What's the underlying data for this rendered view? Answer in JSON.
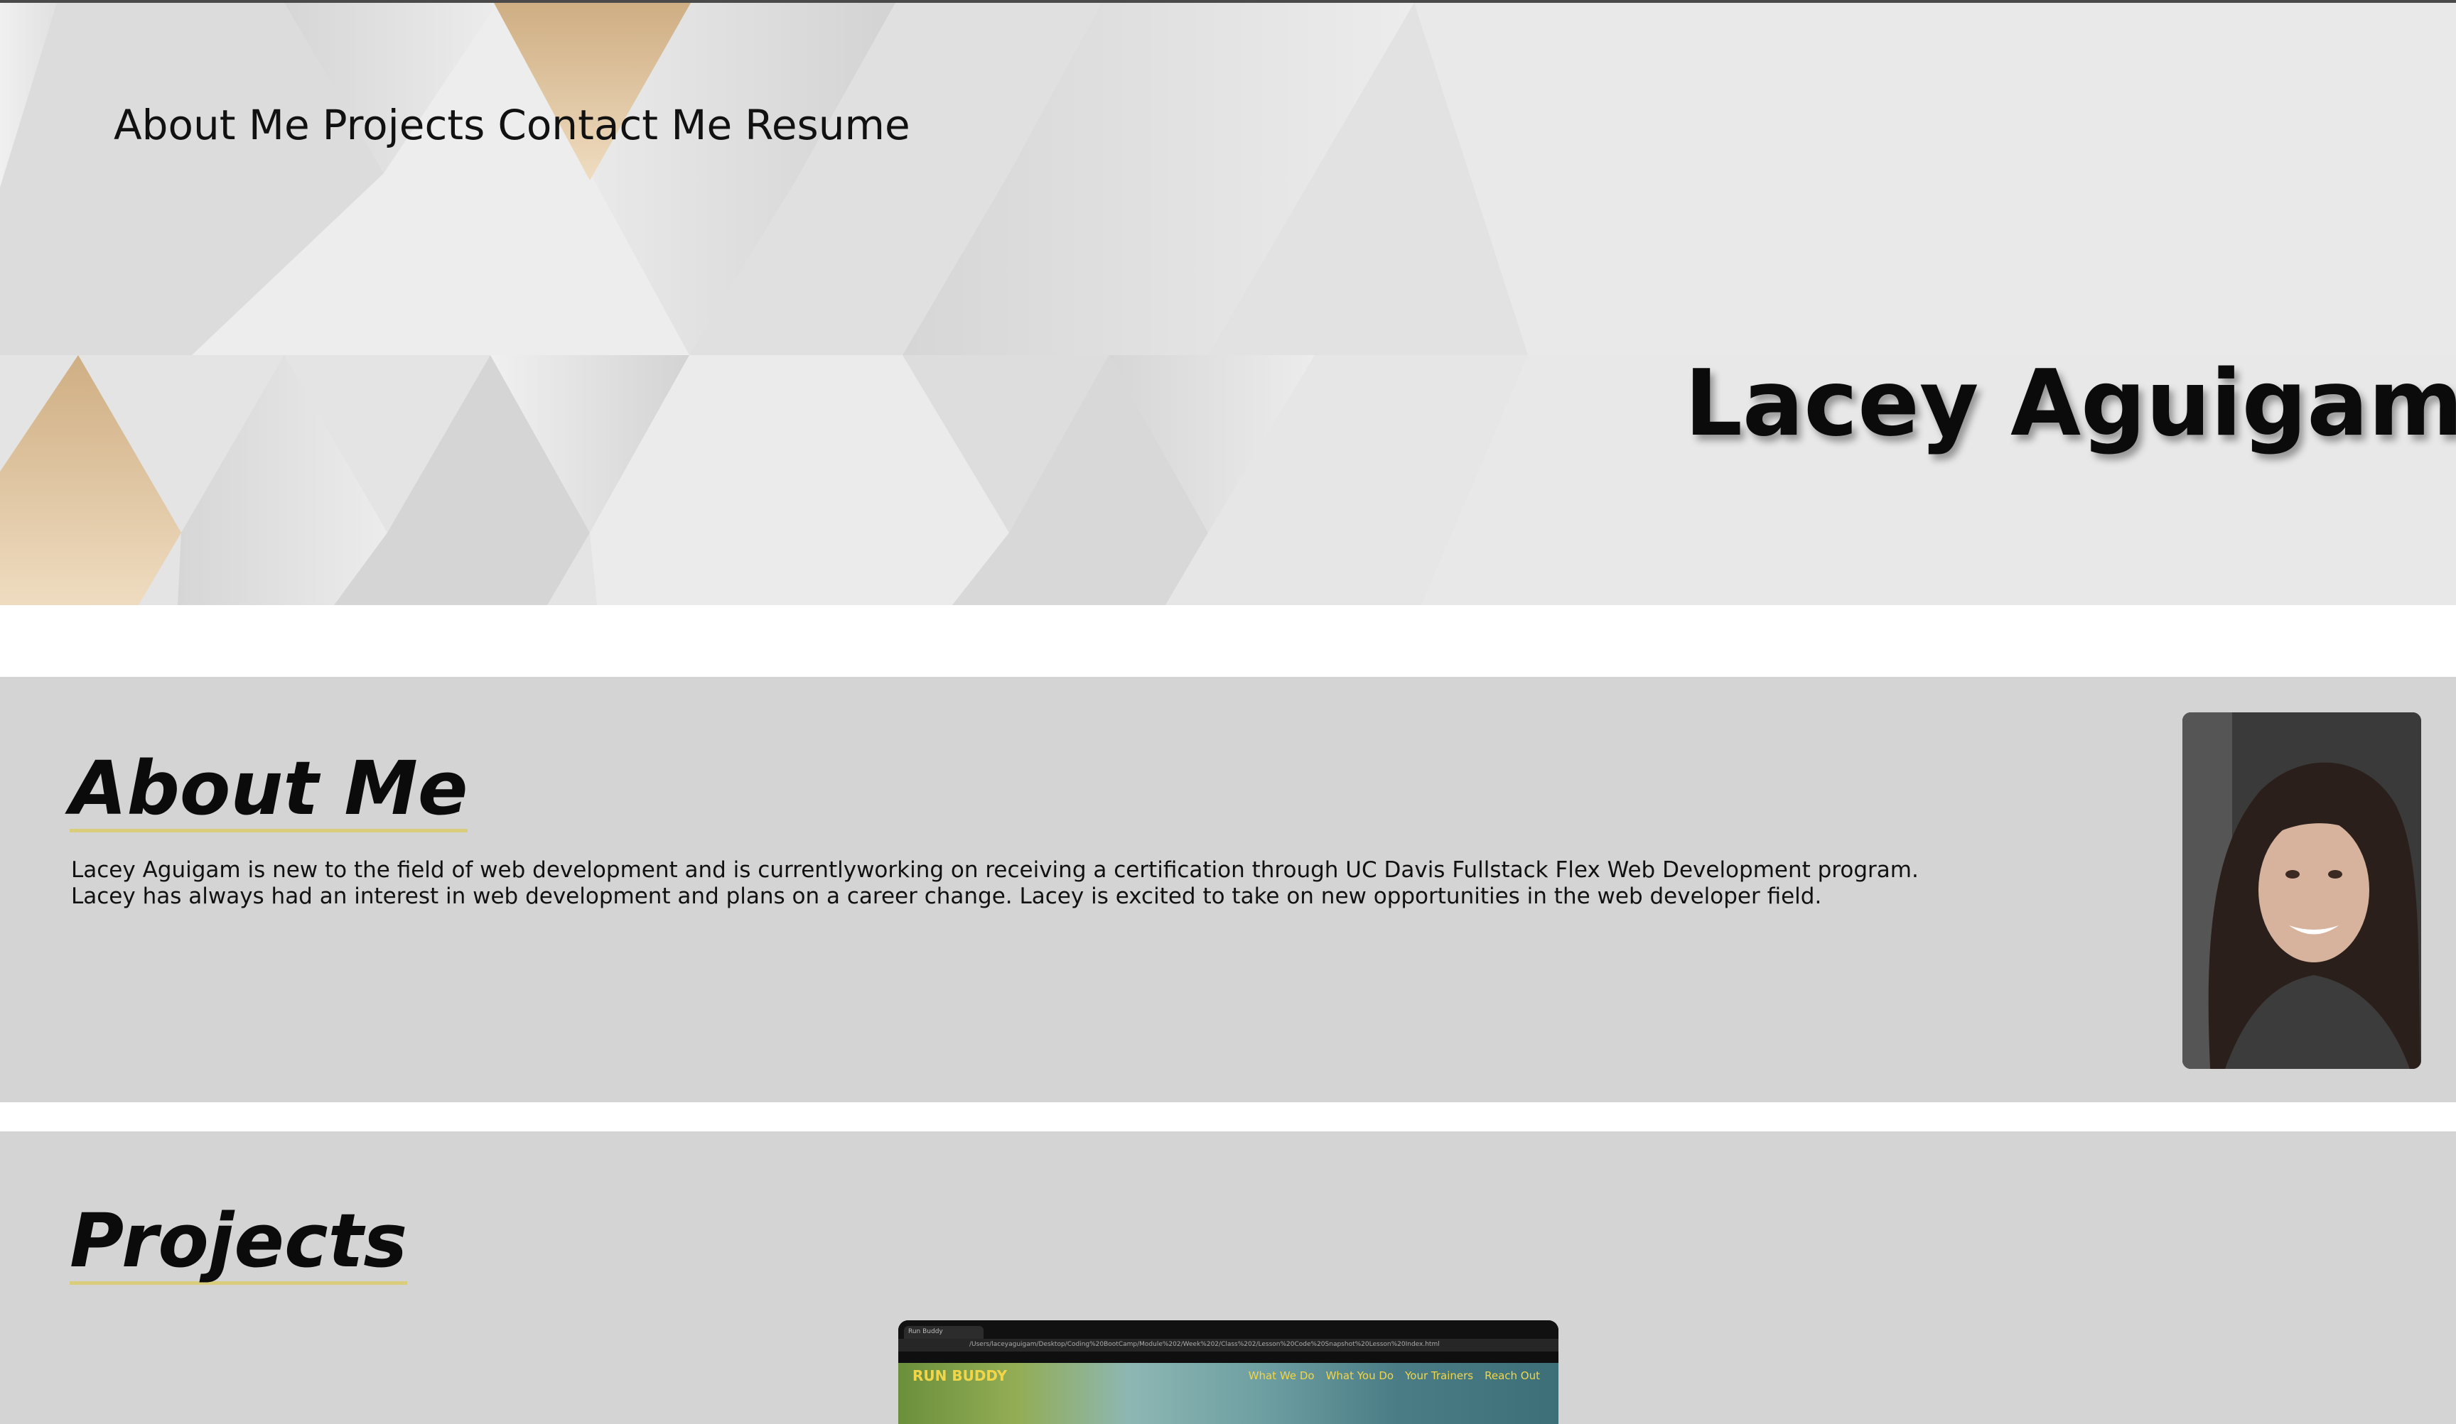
{
  "nav": {
    "items": [
      {
        "label": "About Me"
      },
      {
        "label": "Projects"
      },
      {
        "label": "Contact Me"
      },
      {
        "label": "Resume"
      }
    ]
  },
  "hero": {
    "name": "Lacey Aguigam"
  },
  "about": {
    "title": "About Me",
    "line1": "Lacey Aguigam is new to the field of web development and is currentlyworking on receiving a certification through UC Davis Fullstack Flex Web Development program.",
    "line2": "Lacey has always had an interest in web development and plans on a career change. Lacey is excited to take on new opportunities in the web developer field."
  },
  "projects": {
    "title": "Projects",
    "card": {
      "tab": "Run Buddy",
      "url": "/Users/laceyaguigam/Desktop/Coding%20BootCamp/Module%202/Week%202/Class%202/Lesson%20Code%20Snapshot%20Lesson%20Index.html",
      "brand": "RUN BUDDY",
      "nav": [
        "What We Do",
        "What You Do",
        "Your Trainers",
        "Reach Out"
      ]
    }
  },
  "colors": {
    "hero_bg": "#e6e6e6",
    "section_bg": "#d4d4d4",
    "title_underline": "#d9cc7a",
    "accent_tan": "#d8b98c"
  }
}
